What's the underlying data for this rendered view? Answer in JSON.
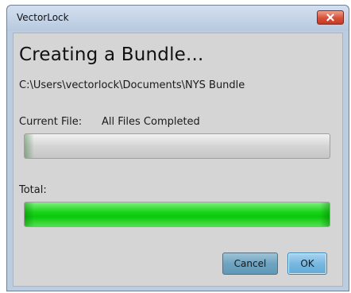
{
  "window": {
    "title": "VectorLock",
    "close_icon": "close-icon"
  },
  "dialog": {
    "heading": "Creating a Bundle...",
    "path": "C:\\Users\\vectorlock\\Documents\\NYS Bundle",
    "current_file_label": "Current File:",
    "current_file_value": "All Files Completed",
    "current_progress": 0,
    "total_label": "Total:",
    "total_progress": 1.0,
    "progress_color": "#1ed41e"
  },
  "buttons": {
    "cancel": "Cancel",
    "ok": "OK"
  }
}
